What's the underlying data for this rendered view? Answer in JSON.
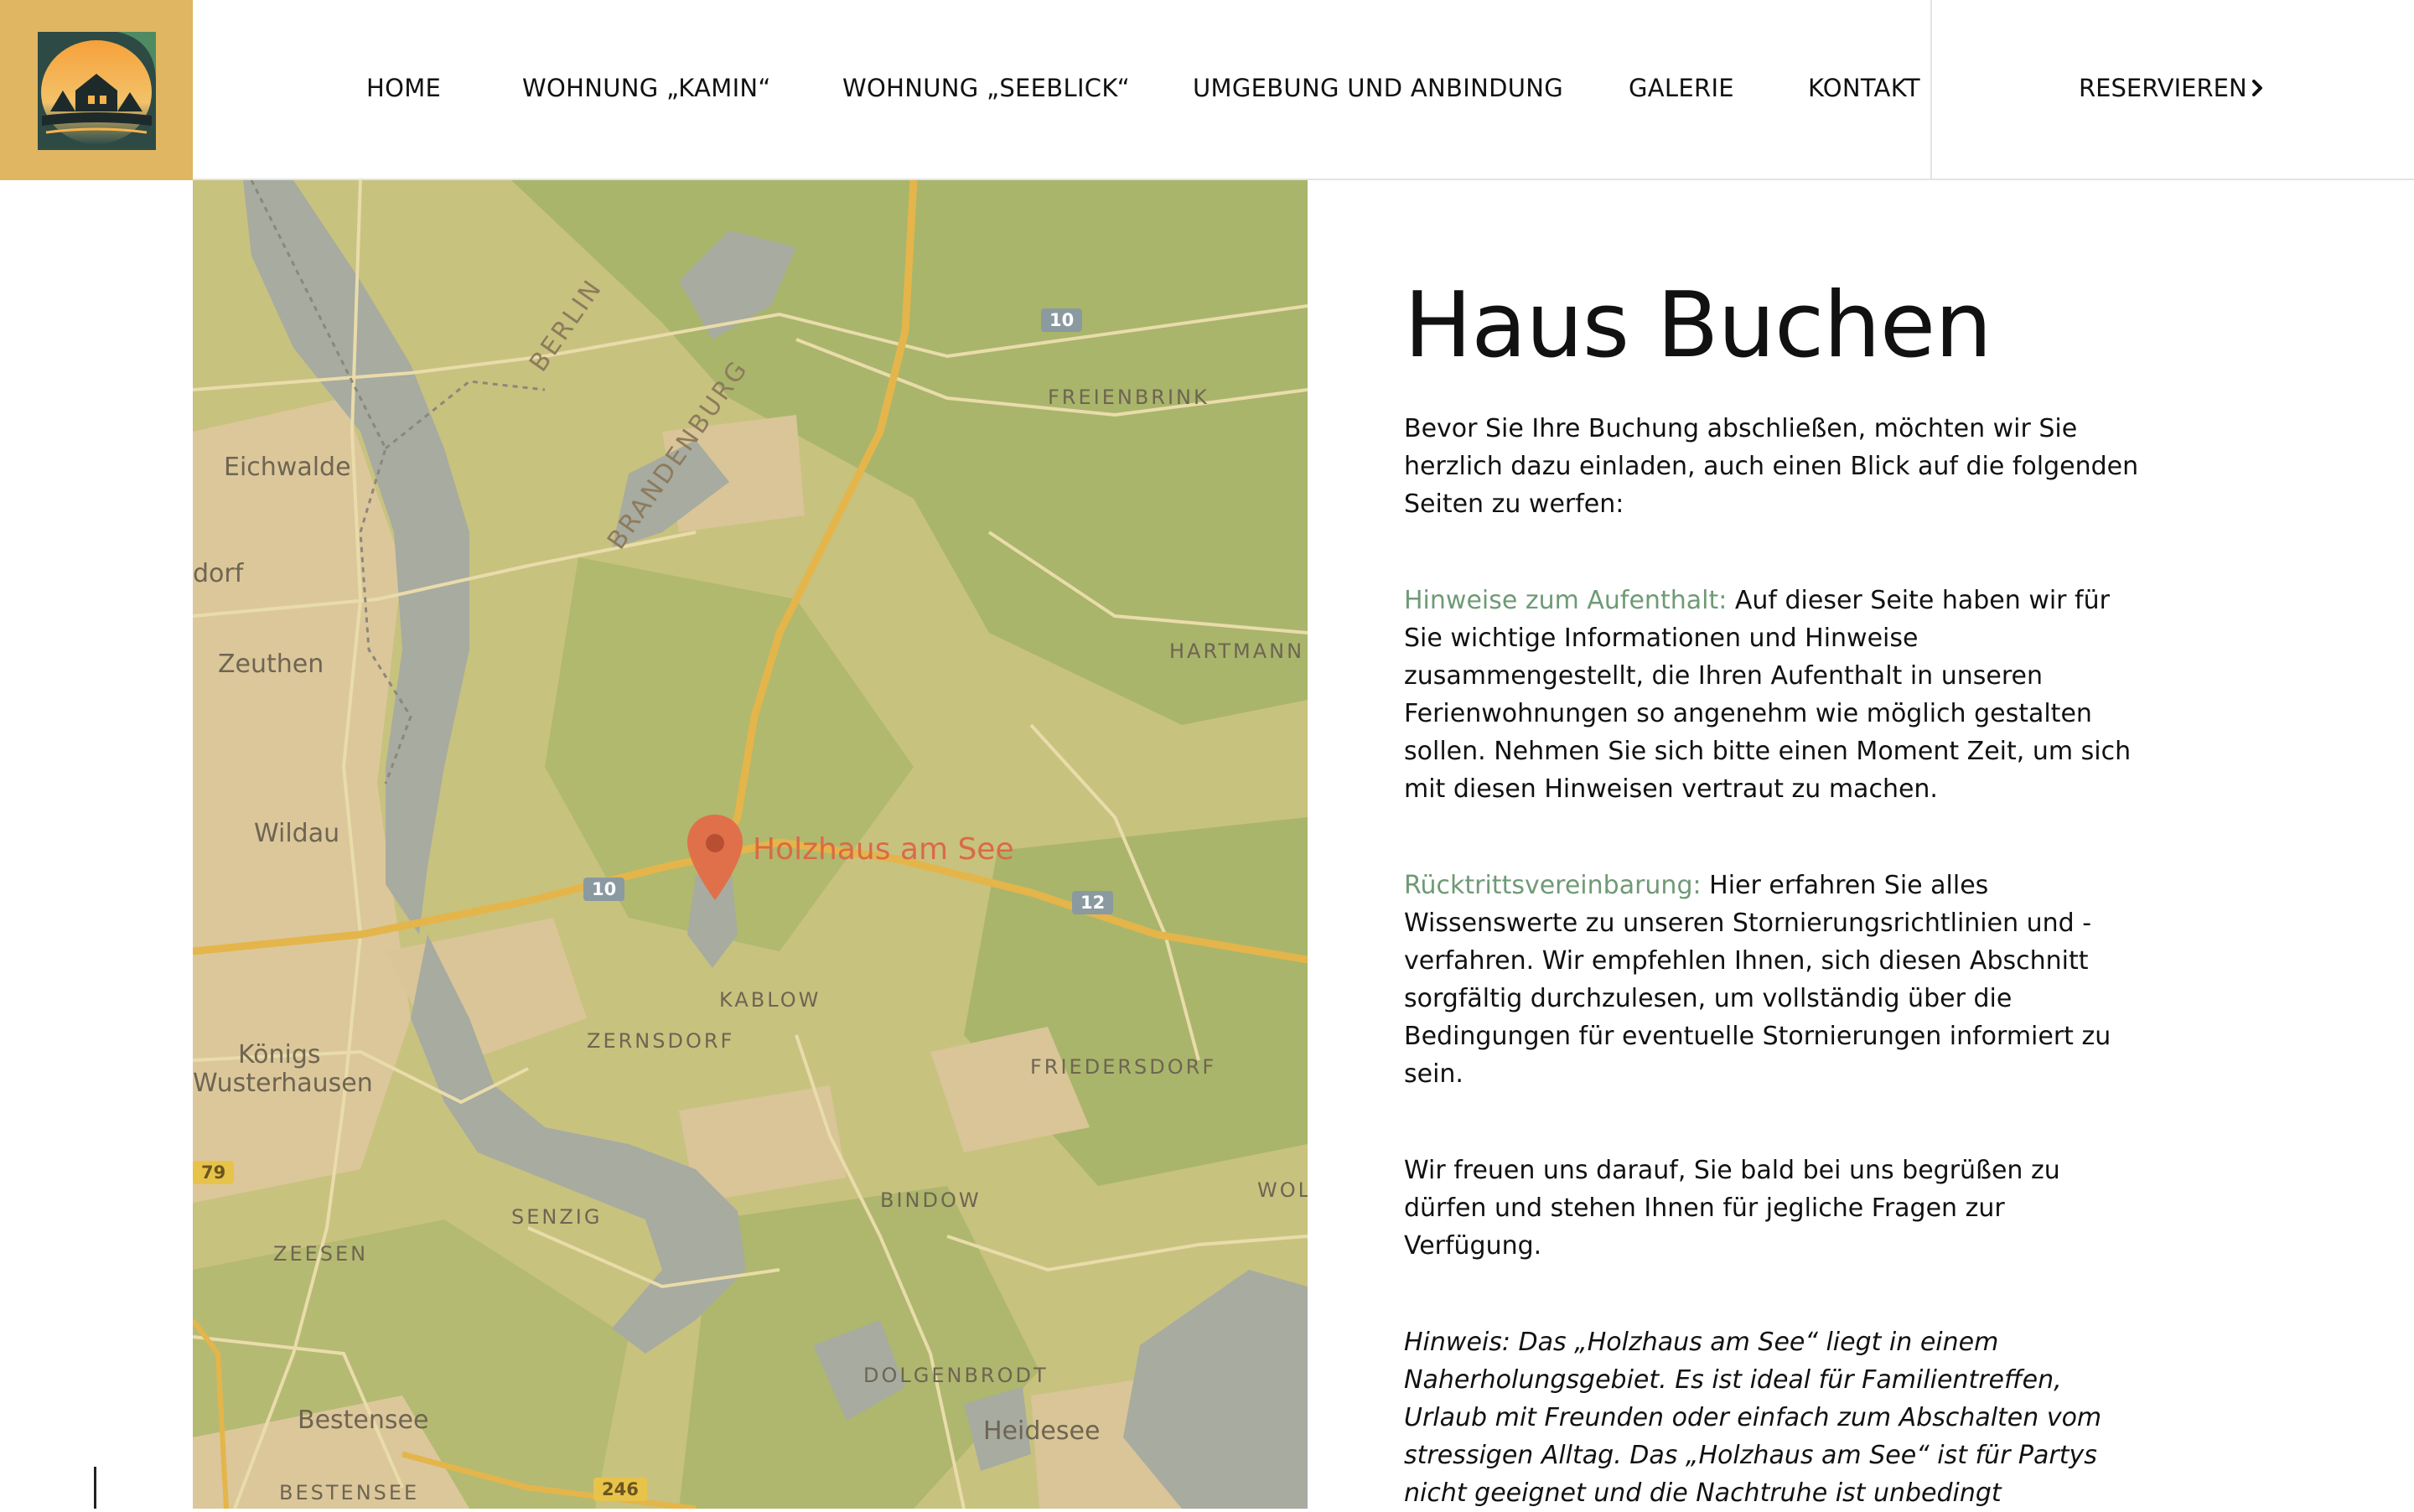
{
  "header": {
    "nav": [
      "HOME",
      "WOHNUNG „KAMIN“",
      "WOHNUNG „SEEBLICK“",
      "UMGEBUNG UND ANBINDUNG",
      "GALERIE",
      "KONTAKT"
    ],
    "reserve_label": "RESERVIEREN"
  },
  "map": {
    "pin_label": "Holzhaus am See",
    "border_labels": [
      "BERLIN",
      "BRANDENBURG"
    ],
    "towns": [
      "Eichwalde",
      "dorf",
      "Zeuthen",
      "Wildau",
      "Königs",
      "Wusterhausen",
      "Bestensee",
      "Heidesee"
    ],
    "villages": [
      "FREIENBRINK",
      "HARTMANN",
      "KABLOW",
      "ZERNSDORF",
      "FRIEDERSDORF",
      "SENZIG",
      "BINDOW",
      "ZEESEN",
      "DOLGENBRODT",
      "BESTENSEE",
      "WOL"
    ],
    "shields": [
      "10",
      "10",
      "12",
      "246",
      "79"
    ]
  },
  "content": {
    "title": "Haus Buchen",
    "intro": "Bevor Sie Ihre Buchung abschließen, möchten wir Sie herzlich dazu einladen, auch einen Blick auf die folgenden Seiten zu werfen:",
    "item1_link": "Hinweise zum Aufenthalt:",
    "item1_text": " Auf dieser Seite haben wir für Sie wichtige Informationen und Hinweise zusammengestellt, die Ihren Aufenthalt in unseren Ferienwohnungen so angenehm wie möglich gestalten sollen. Nehmen Sie sich bitte einen Moment Zeit, um sich mit diesen Hinweisen vertraut zu machen.",
    "item2_link": "Rücktrittsvereinbarung:",
    "item2_text": " Hier erfahren Sie alles Wissenswerte zu unseren Stornierungsrichtlinien und -verfahren. Wir empfehlen Ihnen, sich diesen Abschnitt sorgfältig durchzulesen, um vollständig über die Bedingungen für eventuelle Stornierungen informiert zu sein.",
    "closing": "Wir freuen uns darauf, Sie bald bei uns begrüßen zu dürfen und stehen Ihnen für jegliche Fragen zur Verfügung.",
    "note_lead": "Hinweis:",
    "note_text": " Das „Holzhaus am See“ liegt in einem Naherholungsgebiet. Es ist ideal für Familientreffen, Urlaub mit Freunden oder einfach zum Abschalten vom stressigen Alltag. Das „Holzhaus am See“ ist für Partys nicht geeignet und die Nachtruhe ist unbedingt"
  },
  "colors": {
    "logo_bg": "#e0b662",
    "accent_link": "#6f9a76",
    "pin": "#e0704a",
    "highway": "#e8b94a"
  }
}
